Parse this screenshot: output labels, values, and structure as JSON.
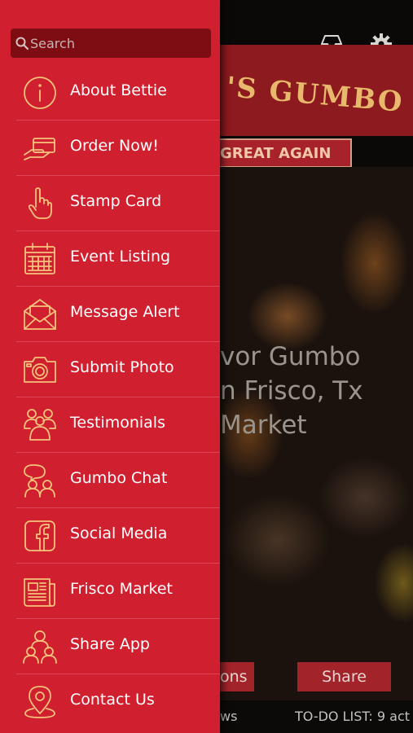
{
  "search": {
    "placeholder": "Search"
  },
  "menu": {
    "items": [
      {
        "label": "About Bettie",
        "icon": "info-icon"
      },
      {
        "label": "Order Now!",
        "icon": "credit-card-hand-icon"
      },
      {
        "label": "Stamp Card",
        "icon": "hand-pointer-icon"
      },
      {
        "label": "Event Listing",
        "icon": "calendar-icon"
      },
      {
        "label": "Message Alert",
        "icon": "envelope-icon"
      },
      {
        "label": "Submit Photo",
        "icon": "camera-icon"
      },
      {
        "label": "Testimonials",
        "icon": "people-group-icon"
      },
      {
        "label": "Gumbo Chat",
        "icon": "people-chat-icon"
      },
      {
        "label": "Social Media",
        "icon": "facebook-icon"
      },
      {
        "label": "Frisco Market",
        "icon": "newspaper-icon"
      },
      {
        "label": "Share App",
        "icon": "people-share-icon"
      },
      {
        "label": "Contact Us",
        "icon": "location-pin-icon"
      }
    ]
  },
  "background": {
    "banner_title": "'S GUMBO",
    "ribbon_text": "GREAT AGAIN",
    "overlay_lines": [
      "vor Gumbo",
      "n Frisco, Tx",
      "Market"
    ],
    "buttons": [
      "ons",
      "Share"
    ],
    "bottom_left": "ws",
    "bottom_right": "TO-DO LIST: 9 act"
  },
  "colors": {
    "drawer": "#d01f2e",
    "search_bg": "#7d0d12",
    "icon_stroke": "#f4c27c",
    "banner": "#8c1a1f",
    "banner_text": "#e8b86c"
  }
}
